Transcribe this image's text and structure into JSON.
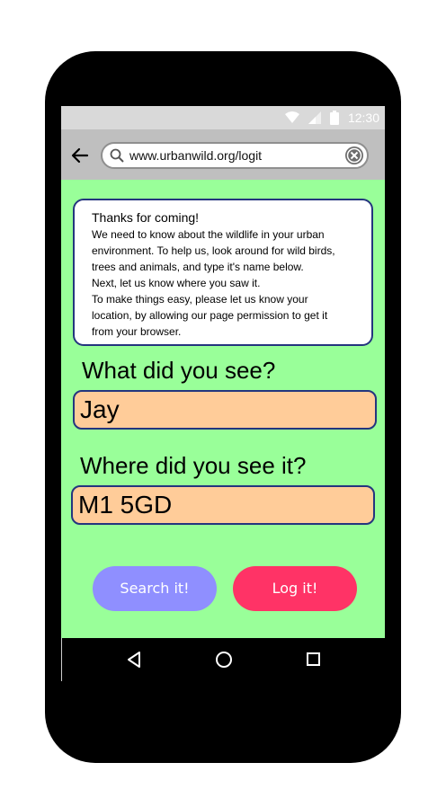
{
  "status_bar": {
    "time": "12:30",
    "icons": [
      "wifi-icon",
      "signal-icon",
      "battery-icon"
    ],
    "color": "#d9d9d9"
  },
  "browser": {
    "url": "www.urbanwild.org/logit",
    "icons": [
      "back-arrow-icon",
      "search-icon",
      "clear-icon"
    ]
  },
  "info": {
    "title": "Thanks for coming!",
    "lines": [
      "We need to know about the wildlife in your urban",
      "environment. To help us, look around for wild birds,",
      "trees and animals, and type it's name below.",
      "Next, let us know where you saw it.",
      "To make things easy, please let us know your",
      "location, by allowing our page permission to get it",
      "from your browser."
    ]
  },
  "form": {
    "what_label": "What did you see?",
    "what_value": "Jay",
    "where_label": "Where did you see it?",
    "where_value": "M1 5GD"
  },
  "buttons": {
    "search_label": "Search it!",
    "log_label": "Log it!"
  },
  "nav": {
    "icons": [
      "back-triangle-icon",
      "home-circle-icon",
      "recents-square-icon"
    ]
  },
  "colors": {
    "page_bg": "#99ff99",
    "info_border": "#24357e",
    "input_bg": "#ffcc99",
    "search_button": "#8f8fff",
    "log_button": "#ff3366",
    "phone_body": "#000000"
  }
}
